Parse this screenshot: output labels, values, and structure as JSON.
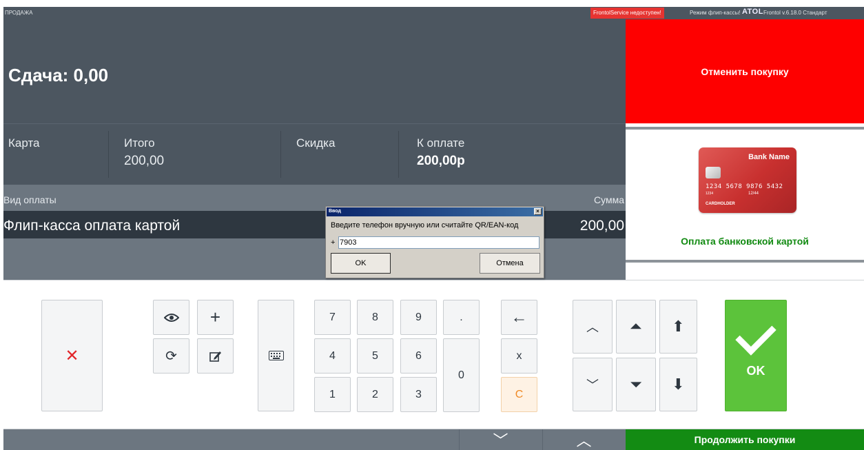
{
  "topbar": {
    "mode": "ПРОДАЖА",
    "service_status": "FrontolService недоступен!",
    "flip_mode": "Режим флип-кассы!",
    "brand": "ATOL",
    "version": "Frontol v.6.18.0 Стандарт"
  },
  "change": {
    "text": "Сдача: 0,00"
  },
  "totals": {
    "card_label": "Карта",
    "total_label": "Итого",
    "total_value": "200,00",
    "discount_label": "Скидка",
    "due_label": "К оплате",
    "due_value": "200,00р"
  },
  "payments": {
    "header_type": "Вид оплаты",
    "header_sum": "Сумма",
    "rows": [
      {
        "type": "Флип-касса оплата картой",
        "sum": "200,00"
      }
    ]
  },
  "right_panel": {
    "cancel_label": "Отменить покупку",
    "card_pay_label": "Оплата банковской картой",
    "card_image": {
      "bank": "Bank Name",
      "number": "1234 5678 9876 5432",
      "small": "1234",
      "valid": "12/44",
      "holder": "CARDHOLDER"
    }
  },
  "keypad": {
    "digits": [
      "7",
      "8",
      "9",
      "4",
      "5",
      "6",
      "1",
      "2",
      "3",
      "0"
    ],
    "dot": ".",
    "multiply": "x",
    "clear": "C",
    "ok": "OK",
    "icons": {
      "cancel": "close-icon",
      "view": "eye-icon",
      "add": "plus-icon",
      "refresh": "refresh-icon",
      "edit": "edit-icon",
      "keyboard": "keyboard-icon",
      "backspace": "arrow-left-icon",
      "up": "chevron-up-icon",
      "down": "chevron-down-icon",
      "page_up": "double-chevron-up-icon",
      "page_down": "double-chevron-down-icon",
      "top": "arrow-up-icon",
      "bottom": "arrow-down-icon"
    }
  },
  "bottom": {
    "continue_label": "Продолжить покупки"
  },
  "dialog": {
    "title": "Ввод",
    "prompt": "Введите телефон вручную или считайте QR/EAN-код",
    "prefix": "+",
    "value": "7903",
    "ok_label": "OK",
    "cancel_label": "Отмена"
  },
  "colors": {
    "dark_panel": "#4c5660",
    "mid_panel": "#6c7680",
    "cancel_red": "#fe0000",
    "pay_green": "#118a11",
    "ok_green": "#5cc33b",
    "continue_green": "#138b13"
  }
}
